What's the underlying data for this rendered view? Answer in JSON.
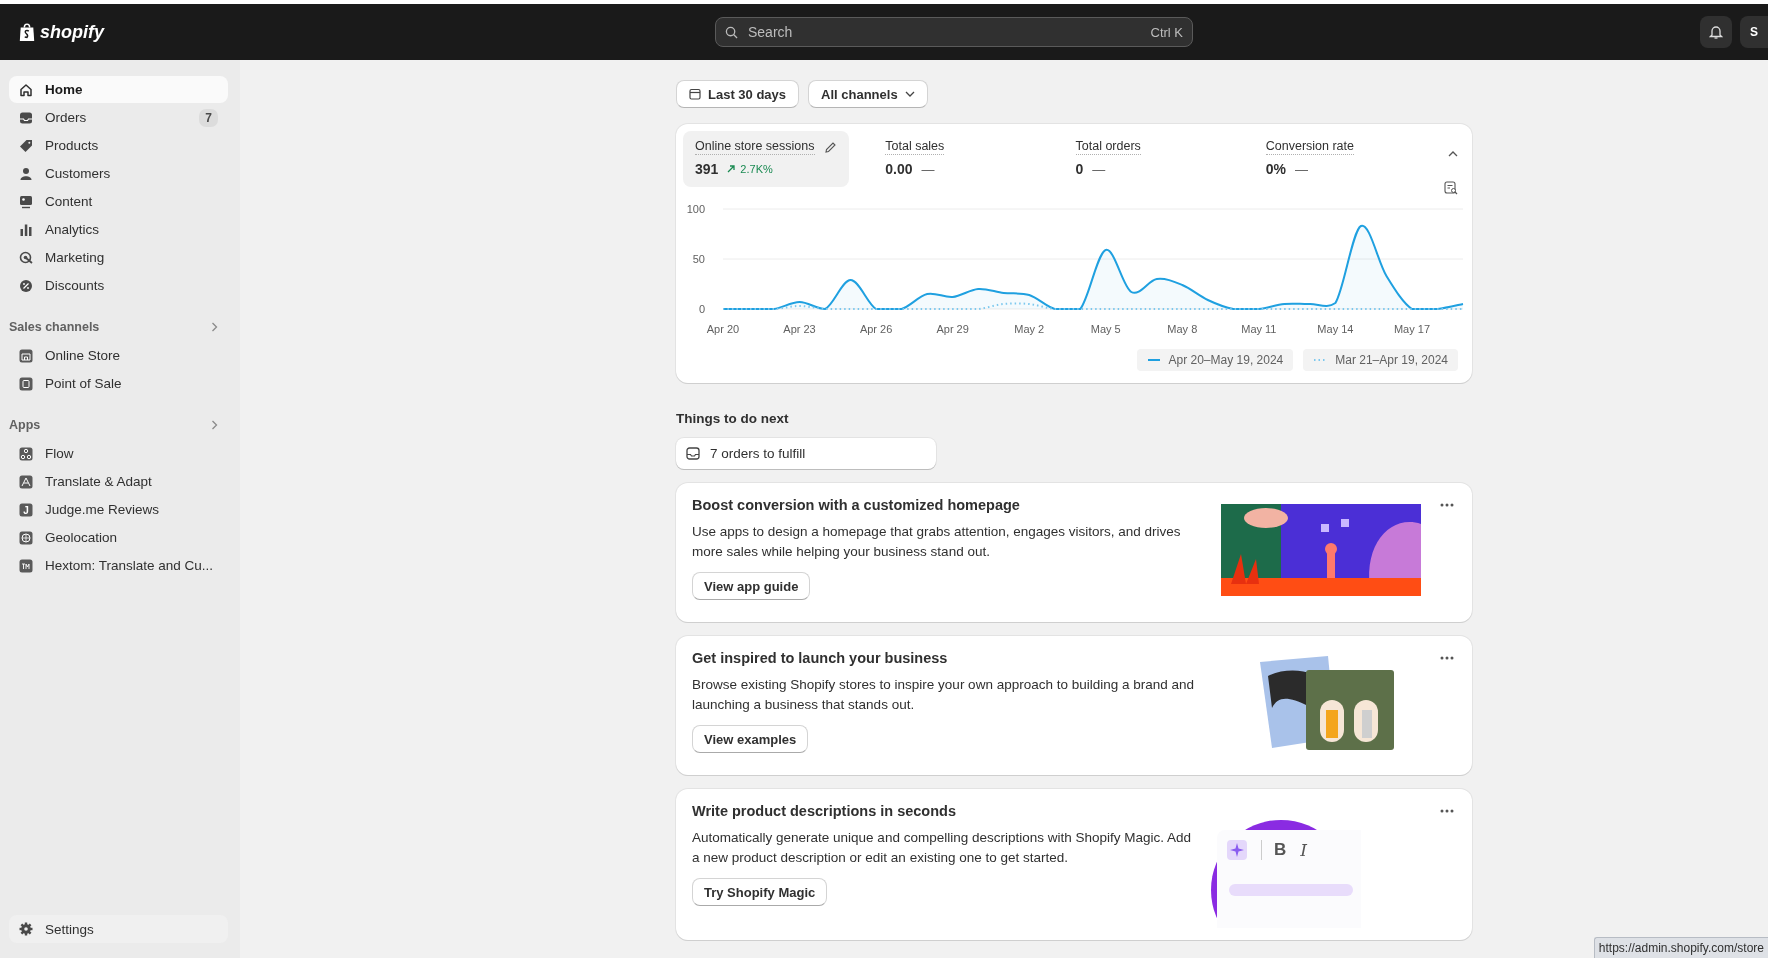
{
  "topbar": {
    "logo": "shopify",
    "search": {
      "placeholder": "Search",
      "shortcut": "Ctrl K"
    },
    "avatar": "S"
  },
  "sidebar": {
    "items": [
      {
        "label": "Home",
        "selected": true
      },
      {
        "label": "Orders",
        "selected": false,
        "badge": "7"
      },
      {
        "label": "Products",
        "selected": false
      },
      {
        "label": "Customers",
        "selected": false
      },
      {
        "label": "Content",
        "selected": false
      },
      {
        "label": "Analytics",
        "selected": false
      },
      {
        "label": "Marketing",
        "selected": false
      },
      {
        "label": "Discounts",
        "selected": false
      }
    ],
    "sections": [
      {
        "title": "Sales channels",
        "items": [
          {
            "label": "Online Store",
            "selected": false
          },
          {
            "label": "Point of Sale",
            "selected": false
          }
        ]
      },
      {
        "title": "Apps",
        "items": [
          {
            "label": "Flow",
            "selected": false
          },
          {
            "label": "Translate & Adapt",
            "selected": false
          },
          {
            "label": "Judge.me Reviews",
            "selected": false,
            "icon_text": "J"
          },
          {
            "label": "Geolocation",
            "selected": false
          },
          {
            "label": "Hextom: Translate and Cu...",
            "selected": false
          }
        ]
      }
    ],
    "settings": {
      "label": "Settings",
      "selected": false
    }
  },
  "filters": [
    {
      "label": "Last 30 days",
      "kind": "date"
    },
    {
      "label": "All channels",
      "kind": "dropdown"
    }
  ],
  "metrics": [
    {
      "label": "Online store sessions",
      "value": "391",
      "change": "2.7K%",
      "selected": true
    },
    {
      "label": "Total sales",
      "value": "0.00",
      "trend": "—",
      "selected": false
    },
    {
      "label": "Total orders",
      "value": "0",
      "trend": "—",
      "selected": false
    },
    {
      "label": "Conversion rate",
      "value": "0%",
      "trend": "—",
      "selected": false
    }
  ],
  "chart_data": {
    "type": "line",
    "legend": "bottom-right",
    "categories": [
      "Apr 20",
      null,
      null,
      "Apr 23",
      null,
      null,
      "Apr 26",
      null,
      null,
      "Apr 29",
      null,
      null,
      "May 2",
      null,
      null,
      "May 5",
      null,
      null,
      "May 8",
      null,
      null,
      "May 11",
      null,
      null,
      "May 14",
      null,
      null,
      "May 17",
      null,
      null
    ],
    "yticks": [
      0,
      50,
      100
    ],
    "ylim": [
      0,
      100
    ],
    "series": [
      {
        "name": "Apr 20–May 19, 2024",
        "color": "#1fa0e0",
        "line_style": "solid",
        "values": [
          0,
          0,
          0,
          7,
          0,
          29,
          0,
          0,
          15,
          12,
          20,
          16,
          14,
          0,
          0,
          59,
          17,
          30,
          24,
          9,
          0,
          0,
          5,
          5,
          6,
          83,
          33,
          0,
          0,
          5
        ]
      },
      {
        "name": "Mar 21–Apr 19, 2024",
        "color": "#7cc8ee",
        "line_style": "dotted",
        "values": [
          0,
          0,
          0,
          3,
          0,
          0,
          0,
          0,
          0,
          0,
          0,
          5,
          5,
          0,
          0,
          0,
          0,
          0,
          0,
          0,
          0,
          0,
          0,
          0,
          0,
          0,
          0,
          0,
          0,
          0
        ]
      }
    ]
  },
  "todo": {
    "title": "Things to do next",
    "task": "7 orders to fulfill"
  },
  "cards": [
    {
      "title": "Boost conversion with a customized homepage",
      "description": "Use apps to design a homepage that grabs attention, engages visitors, and drives more sales while helping your business stand out.",
      "button": "View app guide"
    },
    {
      "title": "Get inspired to launch your business",
      "description": "Browse existing Shopify stores to inspire your own approach to building a brand and launching a business that stands out.",
      "button": "View examples"
    },
    {
      "title": "Write product descriptions in seconds",
      "description": "Automatically generate unique and compelling descriptions with Shopify Magic. Add a new product description or edit an existing one to get started.",
      "button": "Try Shopify Magic",
      "image_text": [
        "B",
        "I"
      ]
    }
  ],
  "status_url": "https://admin.shopify.com/store"
}
